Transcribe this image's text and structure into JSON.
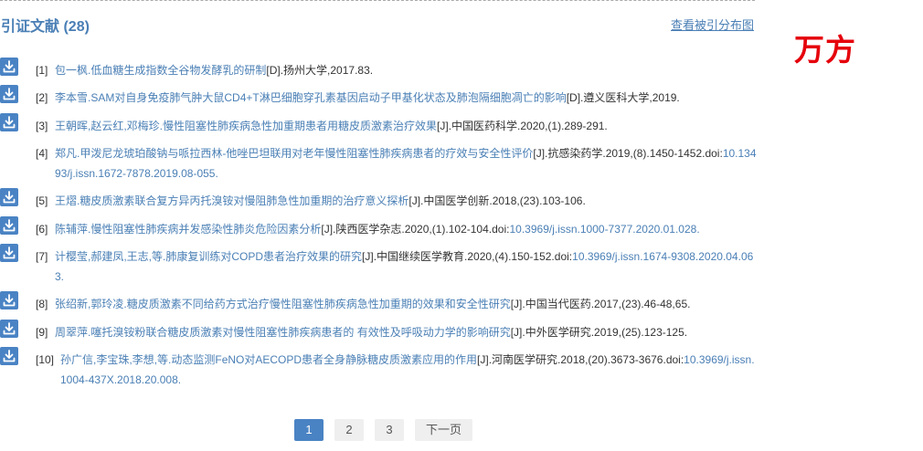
{
  "header": {
    "title": "引证文献",
    "count": "(28)",
    "dist_link": "查看被引分布图"
  },
  "brand": {
    "logo_text": "万方"
  },
  "references": [
    {
      "num": "[1]",
      "authors": "包一枫",
      "title": "低血糖生成指数全谷物发酵乳的研制",
      "source": "[D].扬州大学,2017.83.",
      "doi_prefix": "",
      "doi": ""
    },
    {
      "num": "[2]",
      "authors": "李本雪",
      "title": "SAM对自身免疫肺气肿大鼠CD4+T淋巴细胞穿孔素基因启动子甲基化状态及肺泡隔细胞凋亡的影响",
      "source": "[D].遵义医科大学,2019.",
      "doi_prefix": "",
      "doi": ""
    },
    {
      "num": "[3]",
      "authors": "王朝晖,赵云红,邓梅珍",
      "title": "慢性阻塞性肺疾病急性加重期患者用糖皮质激素治疗效果",
      "source": "[J].中国医药科学.2020,(1).289-291.",
      "doi_prefix": "",
      "doi": ""
    },
    {
      "num": "[4]",
      "authors": "郑凡",
      "title": "甲泼尼龙琥珀酸钠与哌拉西林-他唑巴坦联用对老年慢性阻塞性肺疾病患者的疗效与安全性评价",
      "source": "[J].抗感染药学.2019,(8).1450-1452.",
      "doi_prefix": "doi:",
      "doi": "10.13493/j.issn.1672-7878.2019.08-055."
    },
    {
      "num": "[5]",
      "authors": "王熠",
      "title": "糖皮质激素联合复方异丙托溴铵对慢阻肺急性加重期的治疗意义探析",
      "source": "[J].中国医学创新.2018,(23).103-106.",
      "doi_prefix": "",
      "doi": ""
    },
    {
      "num": "[6]",
      "authors": "陈辅萍",
      "title": "慢性阻塞性肺疾病并发感染性肺炎危险因素分析",
      "source": "[J].陕西医学杂志.2020,(1).102-104.",
      "doi_prefix": "doi:",
      "doi": "10.3969/j.issn.1000-7377.2020.01.028."
    },
    {
      "num": "[7]",
      "authors": "计樱莹,郝建凤,王志,等",
      "title": "肺康复训练对COPD患者治疗效果的研究",
      "source": "[J].中国继续医学教育.2020,(4).150-152.",
      "doi_prefix": "doi:",
      "doi": "10.3969/j.issn.1674-9308.2020.04.063."
    },
    {
      "num": "[8]",
      "authors": "张绍新,郭玲凌",
      "title": "糖皮质激素不同给药方式治疗慢性阻塞性肺疾病急性加重期的效果和安全性研究",
      "source": "[J].中国当代医药.2017,(23).46-48,65.",
      "doi_prefix": "",
      "doi": ""
    },
    {
      "num": "[9]",
      "authors": "周翠萍",
      "title": "噻托溴铵粉联合糖皮质激素对慢性阻塞性肺疾病患者的 有效性及呼吸动力学的影响研究",
      "source": "[J].中外医学研究.2019,(25).123-125.",
      "doi_prefix": "",
      "doi": ""
    },
    {
      "num": "[10]",
      "authors": "孙广信,李宝珠,李想,等",
      "title": "动态监测FeNO对AECOPD患者全身静脉糖皮质激素应用的作用",
      "source": "[J].河南医学研究.2018,(20).3673-3676.",
      "doi_prefix": "doi:",
      "doi": "10.3969/j.issn.1004-437X.2018.20.008."
    }
  ],
  "pagination": {
    "pages": [
      "1",
      "2",
      "3"
    ],
    "active": "1",
    "next_label": "下一页"
  },
  "colors": {
    "link": "#4a7fb5",
    "accent": "#4a83c4",
    "brand": "#e5000b"
  }
}
